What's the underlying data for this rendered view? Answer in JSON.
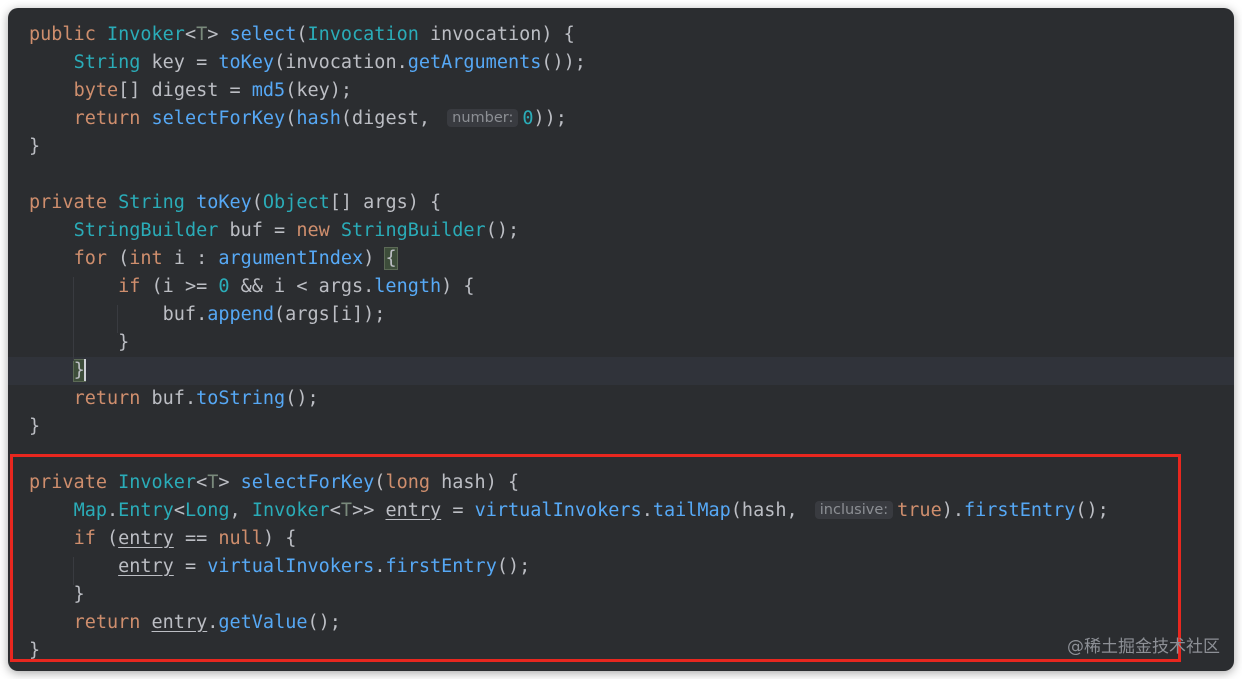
{
  "editor": {
    "hints": {
      "number": "number:",
      "inclusive": "inclusive:"
    }
  },
  "annotation": {
    "label": "highlighted-selectForKey-method"
  },
  "watermark": "@稀土掘金技术社区",
  "colors": {
    "background": "#2b2d30",
    "keyword": "#cf8e6d",
    "type": "#2aacb8",
    "method": "#56a8f5",
    "field": "#c77dbb",
    "highlight_box": "#e8271f"
  }
}
